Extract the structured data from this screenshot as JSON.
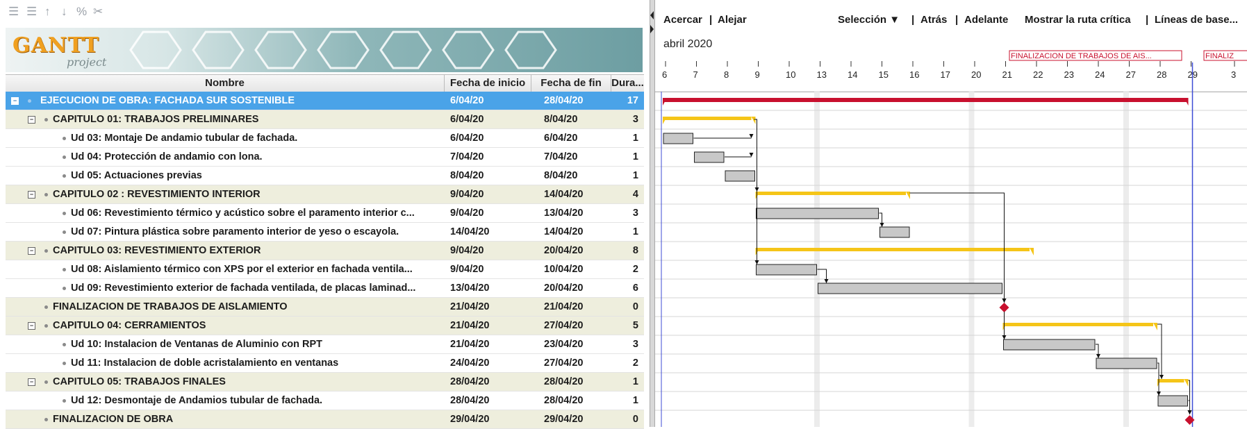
{
  "toolbar": {
    "icons": [
      "indent-icon",
      "outdent-icon",
      "move-up-icon",
      "move-down-icon",
      "link-icon",
      "unlink-icon"
    ]
  },
  "logo": {
    "title": "GANTT",
    "subtitle": "project"
  },
  "columns": {
    "name": "Nombre",
    "start": "Fecha de inicio",
    "end": "Fecha de fin",
    "duration": "Dura..."
  },
  "tasks": [
    {
      "name": "EJECUCION DE OBRA: FACHADA SUR SOSTENIBLE",
      "start": "6/04/20",
      "end": "28/04/20",
      "duration": "17",
      "level": 0,
      "toggle": "-",
      "selected": true
    },
    {
      "name": "CAPITULO 01: TRABAJOS PRELIMINARES",
      "start": "6/04/20",
      "end": "8/04/20",
      "duration": "3",
      "level": 1,
      "toggle": "-"
    },
    {
      "name": "Ud 03: Montaje De andamio tubular de fachada.",
      "start": "6/04/20",
      "end": "6/04/20",
      "duration": "1",
      "level": 2
    },
    {
      "name": "Ud 04: Protección de andamio con lona.",
      "start": "7/04/20",
      "end": "7/04/20",
      "duration": "1",
      "level": 2
    },
    {
      "name": "Ud 05: Actuaciones previas",
      "start": "8/04/20",
      "end": "8/04/20",
      "duration": "1",
      "level": 2
    },
    {
      "name": "CAPITULO 02 : REVESTIMIENTO INTERIOR",
      "start": "9/04/20",
      "end": "14/04/20",
      "duration": "4",
      "level": 1,
      "toggle": "-"
    },
    {
      "name": "Ud 06: Revestimiento térmico y acústico sobre el paramento interior c...",
      "start": "9/04/20",
      "end": "13/04/20",
      "duration": "3",
      "level": 2
    },
    {
      "name": "Ud 07: Pintura plástica sobre paramento interior de yeso o escayola.",
      "start": "14/04/20",
      "end": "14/04/20",
      "duration": "1",
      "level": 2
    },
    {
      "name": "CAPITULO 03: REVESTIMIENTO EXTERIOR",
      "start": "9/04/20",
      "end": "20/04/20",
      "duration": "8",
      "level": 1,
      "toggle": "-"
    },
    {
      "name": "Ud 08: Aislamiento térmico con XPS por el exterior en fachada ventila...",
      "start": "9/04/20",
      "end": "10/04/20",
      "duration": "2",
      "level": 2
    },
    {
      "name": "Ud 09: Revestimiento exterior de fachada ventilada, de placas laminad...",
      "start": "13/04/20",
      "end": "20/04/20",
      "duration": "6",
      "level": 2
    },
    {
      "name": "FINALIZACION DE TRABAJOS DE AISLAMIENTO",
      "start": "21/04/20",
      "end": "21/04/20",
      "duration": "0",
      "level": 1
    },
    {
      "name": "CAPITULO 04: CERRAMIENTOS",
      "start": "21/04/20",
      "end": "27/04/20",
      "duration": "5",
      "level": 1,
      "toggle": "-"
    },
    {
      "name": "Ud 10: Instalacion de Ventanas de Aluminio con RPT",
      "start": "21/04/20",
      "end": "23/04/20",
      "duration": "3",
      "level": 2
    },
    {
      "name": "Ud 11: Instalacion de doble acristalamiento en ventanas",
      "start": "24/04/20",
      "end": "27/04/20",
      "duration": "2",
      "level": 2
    },
    {
      "name": "CAPITULO 05: TRABAJOS FINALES",
      "start": "28/04/20",
      "end": "28/04/20",
      "duration": "1",
      "level": 1,
      "toggle": "-"
    },
    {
      "name": "Ud 12: Desmontaje de Andamios tubular de fachada.",
      "start": "28/04/20",
      "end": "28/04/20",
      "duration": "1",
      "level": 2
    },
    {
      "name": "FINALIZACION DE OBRA",
      "start": "29/04/20",
      "end": "29/04/20",
      "duration": "0",
      "level": 1
    }
  ],
  "gantt_toolbar": {
    "zoom_in": "Acercar",
    "zoom_out": "Alejar",
    "selection": "Selección ▼",
    "back": "Atrás",
    "forward": "Adelante",
    "critical_path": "Mostrar la ruta crítica",
    "baselines": "Líneas de base...",
    "sep": "|"
  },
  "timeline": {
    "month": "abril 2020",
    "days": [
      "6",
      "7",
      "8",
      "9",
      "10",
      "13",
      "14",
      "15",
      "16",
      "17",
      "20",
      "21",
      "22",
      "23",
      "24",
      "27",
      "28",
      "29",
      "3"
    ],
    "milestone_labels": [
      "FINALIZACION DE TRABAJOS DE AIS...",
      "FINALIZ"
    ]
  },
  "colors": {
    "selection": "#4aa3e8",
    "alt_row": "#eeeedd",
    "summary_top": "#c8102e",
    "summary": "#f5c518",
    "task": "#c8c8c8",
    "milestone": "#c8102e",
    "today_line": "#3c4bd6"
  }
}
